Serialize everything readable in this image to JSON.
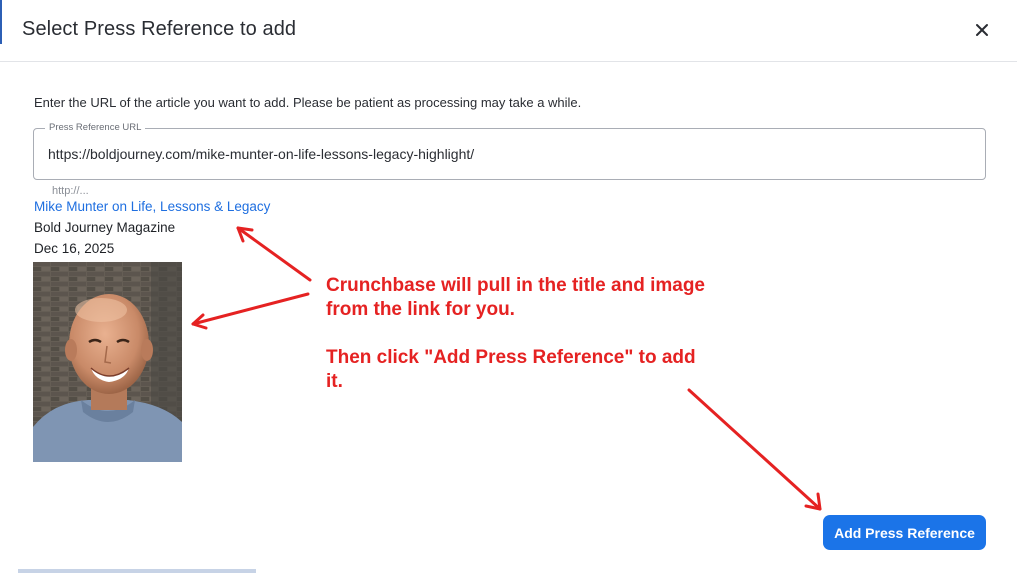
{
  "dialog": {
    "title": "Select Press Reference to add",
    "close_icon": "close-icon",
    "instructions": "Enter the URL of the article you want to add. Please be patient as processing may take a while."
  },
  "url_field": {
    "label": "Press Reference URL",
    "value": "https://boldjourney.com/mike-munter-on-life-lessons-legacy-highlight/",
    "hint": "http://..."
  },
  "preview": {
    "title": "Mike Munter on Life, Lessons & Legacy",
    "source": "Bold Journey Magazine",
    "date": "Dec 16, 2025",
    "image_alt": "portrait-photo"
  },
  "annotations": {
    "line1": "Crunchbase will pull in the title and image",
    "line2": "from the link for you.",
    "line3": "Then click \"Add Press Reference\" to add",
    "line4": "it.",
    "color": "#e52222"
  },
  "footer": {
    "add_button": "Add Press Reference"
  },
  "colors": {
    "primary": "#1b74e8",
    "link": "#1f6fe0"
  }
}
